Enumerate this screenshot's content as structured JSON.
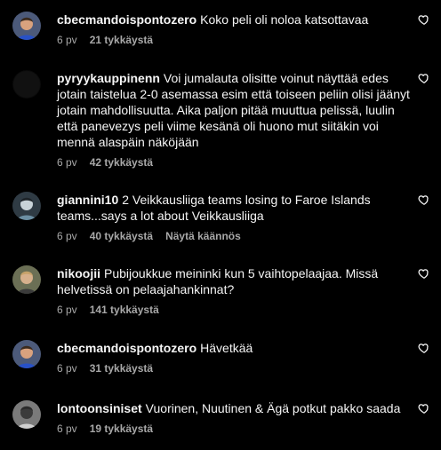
{
  "comments": [
    {
      "username": "cbecmandoispontozero",
      "text": "Koko peli oli noloa katsottavaa",
      "time": "6 pv",
      "likes": "21 tykkäystä",
      "translate": "",
      "avatar": "avatar-kid-blue-shirt",
      "avatar_colors": {
        "bg": "#4c5a7a",
        "face": "#d9a27e",
        "hair": "#3a2a1e",
        "shirt": "#2851c7"
      }
    },
    {
      "username": "pyryykauppinenn",
      "text": "Voi jumalauta olisitte voinut näyttää edes jotain taistelua 2-0 asemassa esim että toiseen peliin olisi jäänyt jotain mahdollisuutta. Aika paljon pitää muuttua pelissä, luulin että panevezys peli viime kesänä oli huono mut siitäkin voi mennä alaspäin näköjään",
      "time": "6 pv",
      "likes": "42 tykkäystä",
      "translate": "",
      "avatar": "avatar-dark",
      "avatar_colors": {
        "bg": "#0b0b0b",
        "face": "#141414",
        "hair": "#0b0b0b",
        "shirt": "#0b0b0b"
      }
    },
    {
      "username": "giannini10",
      "text": "2 Veikkausliiga teams losing to Faroe Islands teams...says a lot about Veikkausliiga",
      "time": "6 pv",
      "likes": "40 tykkäystä",
      "translate": "Näytä käännös",
      "avatar": "avatar-player-teal",
      "avatar_colors": {
        "bg": "#2f3b44",
        "face": "#c9d3d8",
        "hair": "#1d2328",
        "shirt": "#6c8fa3"
      }
    },
    {
      "username": "nikoojii",
      "text": "Pubijoukkue meininki kun 5 vaihtopelaajaa. Missä helvetissä on pelaajahankinnat?",
      "time": "6 pv",
      "likes": "141 tykkäystä",
      "translate": "",
      "avatar": "avatar-man-blond",
      "avatar_colors": {
        "bg": "#6b6f55",
        "face": "#d7b08c",
        "hair": "#c7a26a",
        "shirt": "#3b3b3b"
      }
    },
    {
      "username": "cbecmandoispontozero",
      "text": "Hävetkää",
      "time": "6 pv",
      "likes": "31 tykkäystä",
      "translate": "",
      "avatar": "avatar-kid-blue-shirt",
      "avatar_colors": {
        "bg": "#4c5a7a",
        "face": "#d9a27e",
        "hair": "#3a2a1e",
        "shirt": "#2851c7"
      }
    },
    {
      "username": "lontoonsiniset",
      "text": "Vuorinen, Nuutinen & Ägä potkut pakko saada",
      "time": "6 pv",
      "likes": "19 tykkäystä",
      "translate": "",
      "avatar": "avatar-grey-figure",
      "avatar_colors": {
        "bg": "#7a7a7a",
        "face": "#3b3b3b",
        "hair": "#2a2a2a",
        "shirt": "#cfcfcf"
      }
    }
  ],
  "colors": {
    "background": "#000000",
    "text": "#f5f5f5",
    "meta": "#a8a8a8"
  },
  "icons": {
    "like": "heart-outline-icon"
  }
}
